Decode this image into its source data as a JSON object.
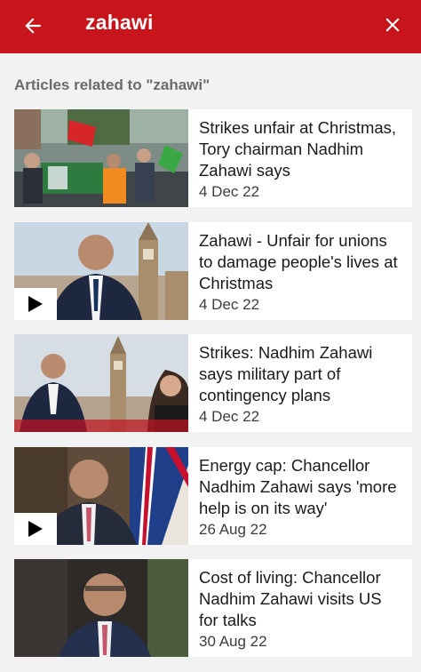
{
  "header": {
    "back_icon": "arrow-left-icon",
    "query": "zahawi",
    "clear_icon": "close-icon",
    "bar_color": "#c8151b"
  },
  "section_title": "Articles related to \"zahawi\"",
  "articles": [
    {
      "headline": "Strikes unfair at Christmas, Tory chairman Nadhim Zahawi says",
      "date": "4 Dec 22",
      "video": false
    },
    {
      "headline": "Zahawi - Unfair for unions to damage people's lives at Christmas",
      "date": "4 Dec 22",
      "video": true
    },
    {
      "headline": "Strikes: Nadhim Zahawi says military part of contingency plans",
      "date": "4 Dec 22",
      "video": false
    },
    {
      "headline": "Energy cap: Chancellor Nadhim Zahawi says 'more help is on its way'",
      "date": "26 Aug 22",
      "video": true
    },
    {
      "headline": "Cost of living: Chancellor Nadhim Zahawi visits US for talks",
      "date": "30 Aug 22",
      "video": false
    }
  ]
}
